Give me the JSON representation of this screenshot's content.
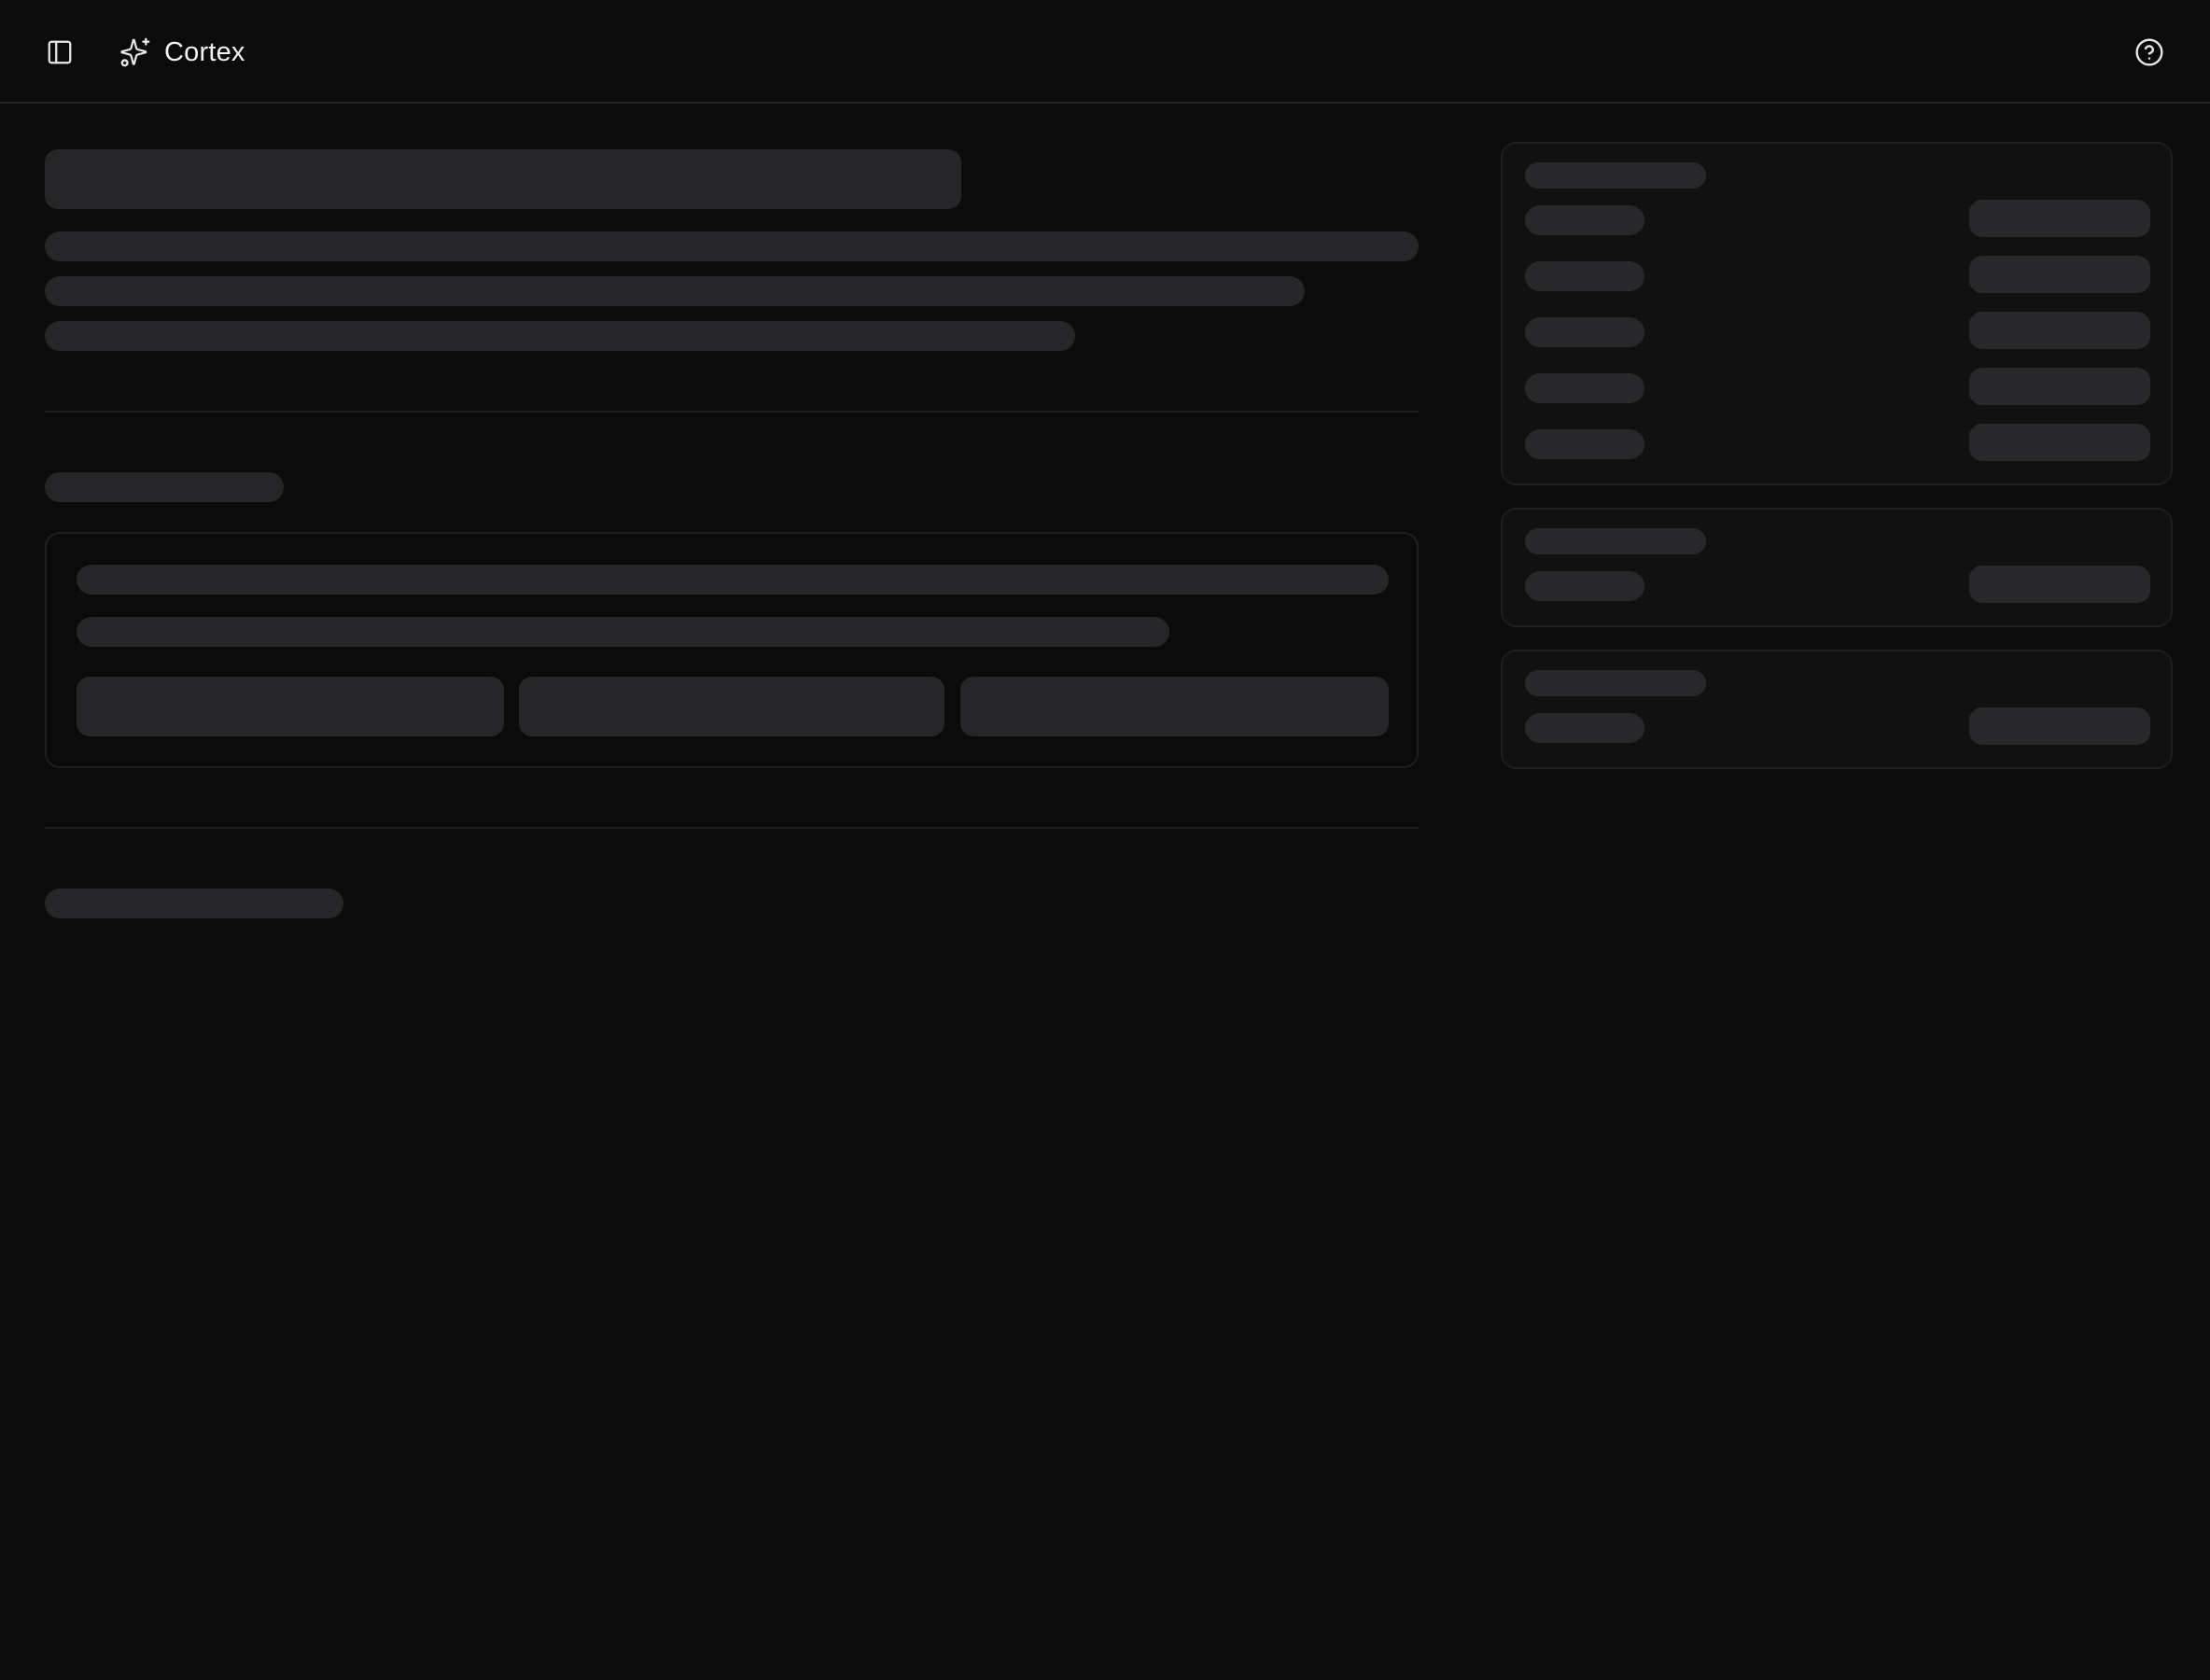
{
  "header": {
    "app_name": "Cortex",
    "sidebar_toggle_icon": "panel-left-icon",
    "brand_icon": "sparkles-icon",
    "help_icon": "help-circle-icon"
  },
  "main": {
    "state": "loading"
  },
  "colors": {
    "background": "#0b0b0c",
    "skeleton": "#262628",
    "border": "#1f1f21",
    "text": "#f2f2f3"
  }
}
